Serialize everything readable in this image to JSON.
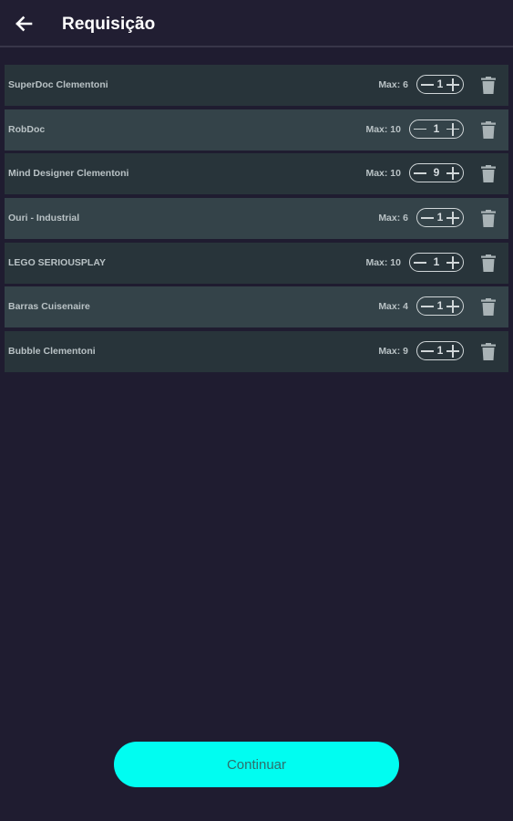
{
  "appbar": {
    "title": "Requisição",
    "back_icon": "arrow-left-icon"
  },
  "items": [
    {
      "name": "SuperDoc Clementoni",
      "max": "Max: 6",
      "quantity": "1"
    },
    {
      "name": "RobDoc",
      "max": "Max: 10",
      "quantity": "1"
    },
    {
      "name": "Mind Designer Clementoni",
      "max": "Max: 10",
      "quantity": "9"
    },
    {
      "name": "Ouri  - Industrial",
      "max": "Max: 6",
      "quantity": "1"
    },
    {
      "name": "LEGO SERIOUSPLAY",
      "max": "Max: 10",
      "quantity": "1"
    },
    {
      "name": "Barras Cuisenaire",
      "max": "Max: 4",
      "quantity": "1"
    },
    {
      "name": "Bubble Clementoni",
      "max": "Max: 9",
      "quantity": "1"
    }
  ],
  "icons": {
    "decrement": "minus-icon",
    "increment": "plus-icon",
    "delete": "trash-icon"
  },
  "actions": {
    "continue_label": "Continuar"
  },
  "colors": {
    "background": "#1f1c30",
    "row": "#28343a",
    "row_alt": "#344349",
    "accent": "#00fdf1"
  }
}
